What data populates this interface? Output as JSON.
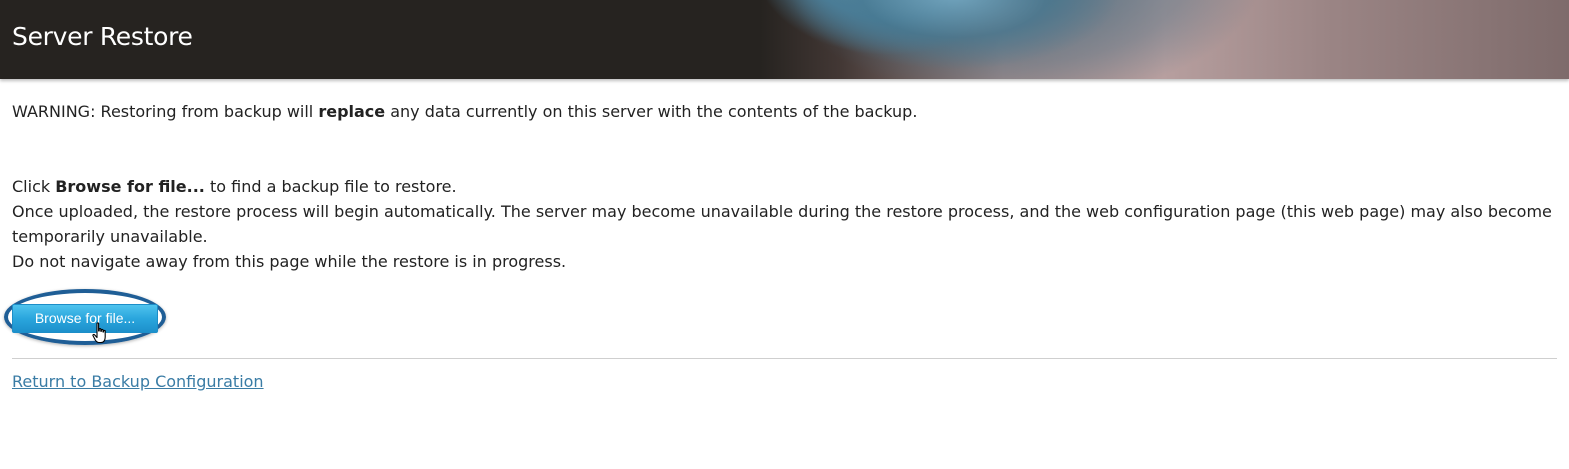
{
  "header": {
    "title": "Server Restore"
  },
  "warning": {
    "prefix": "WARNING: Restoring from backup will ",
    "bold": "replace",
    "suffix": " any data currently on this server with the contents of the backup."
  },
  "instructions": {
    "line1_prefix": "Click ",
    "line1_bold": "Browse for file...",
    "line1_suffix": " to find a backup file to restore.",
    "line2": "Once uploaded, the restore process will begin automatically. The server may become unavailable during the restore process, and the web configuration page (this web page) may also become temporarily unavailable.",
    "line3": "Do not navigate away from this page while the restore is in progress."
  },
  "browse_button": {
    "label": "Browse for file..."
  },
  "return_link": {
    "label": "Return to Backup Configuration"
  },
  "colors": {
    "header_bg": "#262320",
    "button_blue": "#2aa6dd",
    "highlight_oval": "#1f5e96",
    "link": "#3a7ca5"
  },
  "icons": {
    "cursor": "hand-pointer-icon"
  }
}
